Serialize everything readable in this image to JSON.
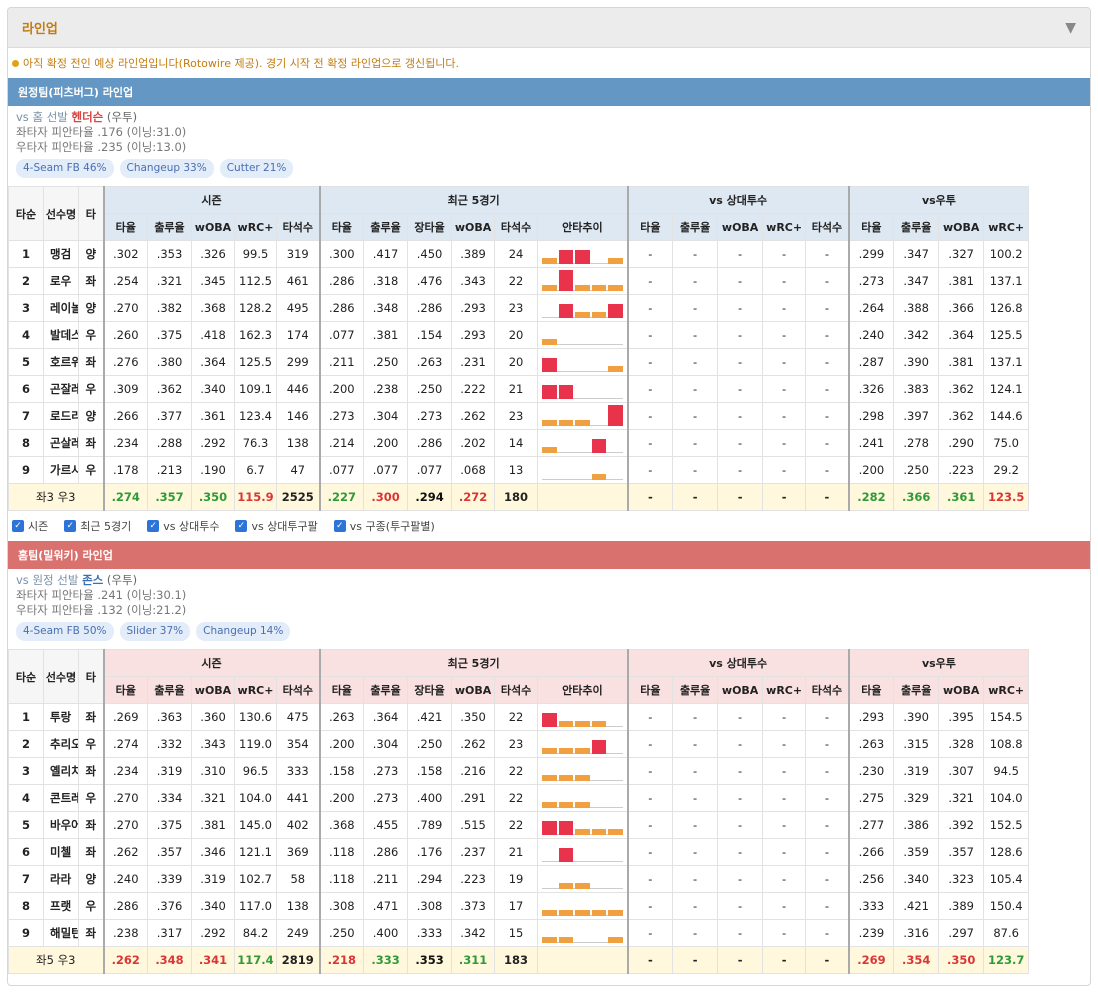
{
  "header": {
    "title": "라인업"
  },
  "notice": "아직 확정 전인 예상 라인업입니다(Rotowire 제공). 경기 시작 전 확정 라인업으로 갱신됩니다.",
  "colors": {
    "accent": "#c27c0e",
    "away_bar": "#6497c3",
    "home_bar": "#d9716f",
    "good": "#2e9a38",
    "bad": "#d93636",
    "trend_hit": "#e8334a",
    "trend_low": "#f0a040"
  },
  "columns": {
    "groups": [
      "시즌",
      "최근 5경기",
      "vs 상대투수",
      "vs우투"
    ],
    "base": [
      "타순",
      "선수명",
      "타"
    ],
    "season": [
      "타율",
      "출루율",
      "wOBA",
      "wRC+",
      "타석수"
    ],
    "recent": [
      "타율",
      "출루율",
      "장타율",
      "wOBA",
      "타석수",
      "안타추이"
    ],
    "vspitcher": [
      "타율",
      "출루율",
      "wOBA",
      "wRC+",
      "타석수"
    ],
    "vshand": [
      "타율",
      "출루율",
      "wOBA",
      "wRC+"
    ]
  },
  "away": {
    "bar_title": "원정팀(피츠버그) 라인업",
    "vs_prefix": "vs 홈 선발",
    "pitcher": "헨더슨",
    "hand": "(우투)",
    "lhb": "좌타자 피안타율 .176 (이닝:31.0)",
    "rhb": "우타자 피안타율 .235 (이닝:13.0)",
    "tags": [
      "4-Seam FB 46%",
      "Changeup 33%",
      "Cutter 21%"
    ],
    "rows": [
      {
        "ord": "1",
        "name": "맹검",
        "hand": "양",
        "s": [
          ".302",
          ".353",
          ".326",
          "99.5",
          "319"
        ],
        "r": [
          ".300",
          ".417",
          ".450",
          ".389",
          "24"
        ],
        "trend": [
          1,
          2,
          2,
          0,
          1
        ],
        "p": [
          "-",
          "-",
          "-",
          "-",
          "-"
        ],
        "h": [
          ".299",
          ".347",
          ".327",
          "100.2"
        ]
      },
      {
        "ord": "2",
        "name": "로우",
        "hand": "좌",
        "s": [
          ".254",
          ".321",
          ".345",
          "112.5",
          "461"
        ],
        "r": [
          ".286",
          ".318",
          ".476",
          ".343",
          "22"
        ],
        "trend": [
          1,
          3,
          1,
          1,
          1
        ],
        "p": [
          "-",
          "-",
          "-",
          "-",
          "-"
        ],
        "h": [
          ".273",
          ".347",
          ".381",
          "137.1"
        ]
      },
      {
        "ord": "3",
        "name": "레이놀즈",
        "hand": "양",
        "s": [
          ".270",
          ".382",
          ".368",
          "128.2",
          "495"
        ],
        "r": [
          ".286",
          ".348",
          ".286",
          ".293",
          "23"
        ],
        "trend": [
          0,
          2,
          1,
          1,
          2
        ],
        "p": [
          "-",
          "-",
          "-",
          "-",
          "-"
        ],
        "h": [
          ".264",
          ".388",
          ".366",
          "126.8"
        ]
      },
      {
        "ord": "4",
        "name": "발데스",
        "hand": "우",
        "s": [
          ".260",
          ".375",
          ".418",
          "162.3",
          "174"
        ],
        "r": [
          ".077",
          ".381",
          ".154",
          ".293",
          "20"
        ],
        "trend": [
          1,
          0,
          0,
          0,
          0
        ],
        "p": [
          "-",
          "-",
          "-",
          "-",
          "-"
        ],
        "h": [
          ".240",
          ".342",
          ".364",
          "125.5"
        ]
      },
      {
        "ord": "5",
        "name": "호르위츠",
        "hand": "좌",
        "s": [
          ".276",
          ".380",
          ".364",
          "125.5",
          "299"
        ],
        "r": [
          ".211",
          ".250",
          ".263",
          ".231",
          "20"
        ],
        "trend": [
          2,
          0,
          0,
          0,
          1
        ],
        "p": [
          "-",
          "-",
          "-",
          "-",
          "-"
        ],
        "h": [
          ".287",
          ".390",
          ".381",
          "137.1"
        ]
      },
      {
        "ord": "6",
        "name": "곤잘레스",
        "hand": "우",
        "s": [
          ".309",
          ".362",
          ".340",
          "109.1",
          "446"
        ],
        "r": [
          ".200",
          ".238",
          ".250",
          ".222",
          "21"
        ],
        "trend": [
          2,
          2,
          0,
          0,
          0
        ],
        "p": [
          "-",
          "-",
          "-",
          "-",
          "-"
        ],
        "h": [
          ".326",
          ".383",
          ".362",
          "124.1"
        ]
      },
      {
        "ord": "7",
        "name": "로드리게스",
        "hand": "양",
        "s": [
          ".266",
          ".377",
          ".361",
          "123.4",
          "146"
        ],
        "r": [
          ".273",
          ".304",
          ".273",
          ".262",
          "23"
        ],
        "trend": [
          1,
          1,
          1,
          0,
          3
        ],
        "p": [
          "-",
          "-",
          "-",
          "-",
          "-"
        ],
        "h": [
          ".298",
          ".397",
          ".362",
          "144.6"
        ]
      },
      {
        "ord": "8",
        "name": "곤살레스",
        "hand": "좌",
        "s": [
          ".234",
          ".288",
          ".292",
          "76.3",
          "138"
        ],
        "r": [
          ".214",
          ".200",
          ".286",
          ".202",
          "14"
        ],
        "trend": [
          1,
          0,
          0,
          2,
          0
        ],
        "p": [
          "-",
          "-",
          "-",
          "-",
          "-"
        ],
        "h": [
          ".241",
          ".278",
          ".290",
          "75.0"
        ]
      },
      {
        "ord": "9",
        "name": "가르시아",
        "hand": "우",
        "s": [
          ".178",
          ".213",
          ".190",
          "6.7",
          "47"
        ],
        "r": [
          ".077",
          ".077",
          ".077",
          ".068",
          "13"
        ],
        "trend": [
          0,
          0,
          0,
          1,
          0
        ],
        "p": [
          "-",
          "-",
          "-",
          "-",
          "-"
        ],
        "h": [
          ".200",
          ".250",
          ".223",
          "29.2"
        ]
      }
    ],
    "total": {
      "label": "좌3 우3",
      "s": [
        ".274",
        ".357",
        ".350",
        "115.9",
        "2525"
      ],
      "r": [
        ".227",
        ".300",
        ".294",
        ".272",
        "180"
      ],
      "p": [
        "-",
        "-",
        "-",
        "-",
        "-"
      ],
      "h": [
        ".282",
        ".366",
        ".361",
        "123.5"
      ]
    }
  },
  "options": [
    "시즌",
    "최근 5경기",
    "vs 상대투수",
    "vs 상대투구팔",
    "vs 구종(투구팔별)"
  ],
  "home": {
    "bar_title": "홈팀(밀워키) 라인업",
    "vs_prefix": "vs 원정 선발",
    "pitcher": "존스",
    "hand": "(우투)",
    "lhb": "좌타자 피안타율 .241 (이닝:30.1)",
    "rhb": "우타자 피안타율 .132 (이닝:21.2)",
    "tags": [
      "4-Seam FB 50%",
      "Slider 37%",
      "Changeup 14%"
    ],
    "rows": [
      {
        "ord": "1",
        "name": "투랑",
        "hand": "좌",
        "s": [
          ".269",
          ".363",
          ".360",
          "130.6",
          "475"
        ],
        "r": [
          ".263",
          ".364",
          ".421",
          ".350",
          "22"
        ],
        "trend": [
          2,
          1,
          1,
          1,
          0
        ],
        "p": [
          "-",
          "-",
          "-",
          "-",
          "-"
        ],
        "h": [
          ".293",
          ".390",
          ".395",
          "154.5"
        ]
      },
      {
        "ord": "2",
        "name": "추리오",
        "hand": "우",
        "s": [
          ".274",
          ".332",
          ".343",
          "119.0",
          "354"
        ],
        "r": [
          ".200",
          ".304",
          ".250",
          ".262",
          "23"
        ],
        "trend": [
          1,
          1,
          1,
          2,
          0
        ],
        "p": [
          "-",
          "-",
          "-",
          "-",
          "-"
        ],
        "h": [
          ".263",
          ".315",
          ".328",
          "108.8"
        ]
      },
      {
        "ord": "3",
        "name": "옐리치",
        "hand": "좌",
        "s": [
          ".234",
          ".319",
          ".310",
          "96.5",
          "333"
        ],
        "r": [
          ".158",
          ".273",
          ".158",
          ".216",
          "22"
        ],
        "trend": [
          1,
          1,
          1,
          0,
          0
        ],
        "p": [
          "-",
          "-",
          "-",
          "-",
          "-"
        ],
        "h": [
          ".230",
          ".319",
          ".307",
          "94.5"
        ]
      },
      {
        "ord": "4",
        "name": "콘트레라스",
        "hand": "우",
        "s": [
          ".270",
          ".334",
          ".321",
          "104.0",
          "441"
        ],
        "r": [
          ".200",
          ".273",
          ".400",
          ".291",
          "22"
        ],
        "trend": [
          1,
          1,
          1,
          0,
          0
        ],
        "p": [
          "-",
          "-",
          "-",
          "-",
          "-"
        ],
        "h": [
          ".275",
          ".329",
          ".321",
          "104.0"
        ]
      },
      {
        "ord": "5",
        "name": "바우어스",
        "hand": "좌",
        "s": [
          ".270",
          ".375",
          ".381",
          "145.0",
          "402"
        ],
        "r": [
          ".368",
          ".455",
          ".789",
          ".515",
          "22"
        ],
        "trend": [
          2,
          2,
          1,
          1,
          1
        ],
        "p": [
          "-",
          "-",
          "-",
          "-",
          "-"
        ],
        "h": [
          ".277",
          ".386",
          ".392",
          "152.5"
        ]
      },
      {
        "ord": "6",
        "name": "미첼",
        "hand": "좌",
        "s": [
          ".262",
          ".357",
          ".346",
          "121.1",
          "369"
        ],
        "r": [
          ".118",
          ".286",
          ".176",
          ".237",
          "21"
        ],
        "trend": [
          0,
          2,
          0,
          0,
          0
        ],
        "p": [
          "-",
          "-",
          "-",
          "-",
          "-"
        ],
        "h": [
          ".266",
          ".359",
          ".357",
          "128.6"
        ]
      },
      {
        "ord": "7",
        "name": "라라",
        "hand": "양",
        "s": [
          ".240",
          ".339",
          ".319",
          "102.7",
          "58"
        ],
        "r": [
          ".118",
          ".211",
          ".294",
          ".223",
          "19"
        ],
        "trend": [
          0,
          1,
          1,
          0,
          0
        ],
        "p": [
          "-",
          "-",
          "-",
          "-",
          "-"
        ],
        "h": [
          ".256",
          ".340",
          ".323",
          "105.4"
        ]
      },
      {
        "ord": "8",
        "name": "프랫",
        "hand": "우",
        "s": [
          ".286",
          ".376",
          ".340",
          "117.0",
          "138"
        ],
        "r": [
          ".308",
          ".471",
          ".308",
          ".373",
          "17"
        ],
        "trend": [
          1,
          1,
          1,
          1,
          1
        ],
        "p": [
          "-",
          "-",
          "-",
          "-",
          "-"
        ],
        "h": [
          ".333",
          ".421",
          ".389",
          "150.4"
        ]
      },
      {
        "ord": "9",
        "name": "해밀턴",
        "hand": "좌",
        "s": [
          ".238",
          ".317",
          ".292",
          "84.2",
          "249"
        ],
        "r": [
          ".250",
          ".400",
          ".333",
          ".342",
          "15"
        ],
        "trend": [
          1,
          1,
          0,
          0,
          1
        ],
        "p": [
          "-",
          "-",
          "-",
          "-",
          "-"
        ],
        "h": [
          ".239",
          ".316",
          ".297",
          "87.6"
        ]
      }
    ],
    "total": {
      "label": "좌5 우3",
      "s": [
        ".262",
        ".348",
        ".341",
        "117.4",
        "2819"
      ],
      "r": [
        ".218",
        ".333",
        ".353",
        ".311",
        "183"
      ],
      "p": [
        "-",
        "-",
        "-",
        "-",
        "-"
      ],
      "h": [
        ".269",
        ".354",
        ".350",
        "123.7"
      ]
    }
  }
}
